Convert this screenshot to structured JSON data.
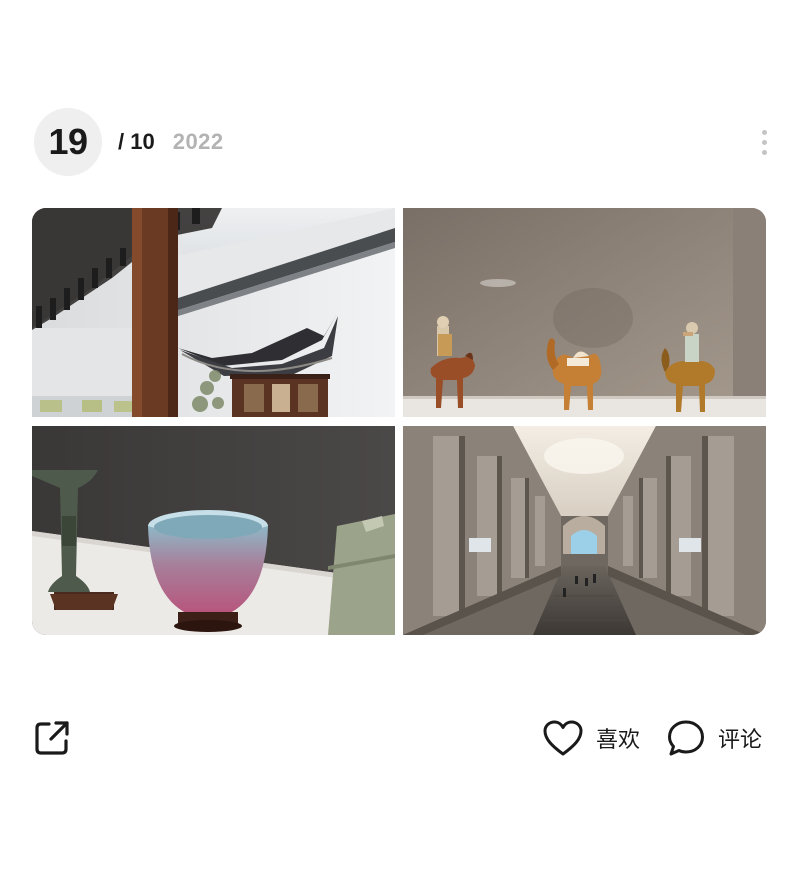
{
  "post": {
    "day": "19",
    "month": "/ 10",
    "year": "2022"
  },
  "photos": [
    {
      "name": "photo-chinese-garden-pavilion",
      "subject": "Chinese garden courtyard with pavilion roof"
    },
    {
      "name": "photo-tang-horse-camel-figurines",
      "subject": "Sancai glazed horse and camel figurines in a display case"
    },
    {
      "name": "photo-porcelain-bowl-bronze-vessel",
      "subject": "Jun-ware bowl and archaic bronze vessel on display"
    },
    {
      "name": "photo-museum-great-hall-corridor",
      "subject": "Grand colonnaded museum hall with staircase"
    }
  ],
  "actions": {
    "like_label": "喜欢",
    "comment_label": "评论"
  },
  "icons": {
    "share": "share-icon",
    "like": "heart-icon",
    "comment": "comment-bubble-icon",
    "more": "more-vertical-icon"
  }
}
